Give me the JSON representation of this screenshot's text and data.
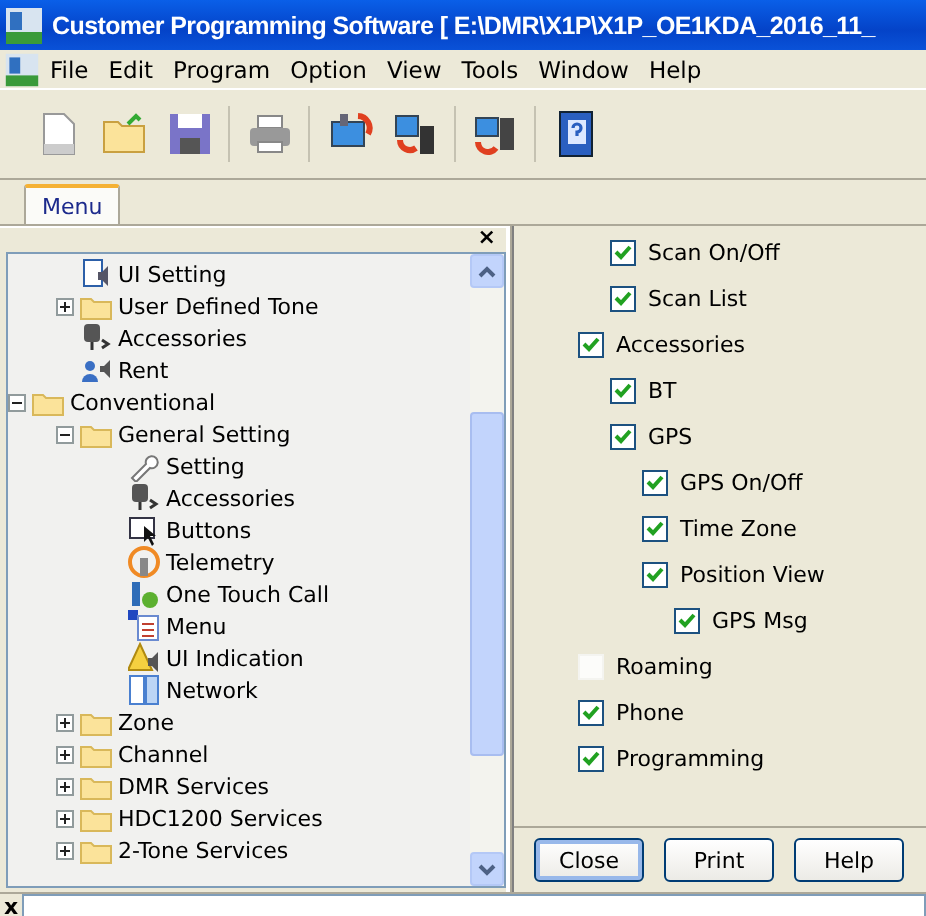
{
  "window": {
    "title": "Customer Programming Software [ E:\\DMR\\X1P\\X1P_OE1KDA_2016_11_"
  },
  "menu_bar": [
    "File",
    "Edit",
    "Program",
    "Option",
    "View",
    "Tools",
    "Window",
    "Help"
  ],
  "toolbar": [
    {
      "kind": "new"
    },
    {
      "kind": "open"
    },
    {
      "kind": "save"
    },
    {
      "kind": "sep"
    },
    {
      "kind": "print"
    },
    {
      "kind": "sep"
    },
    {
      "kind": "read"
    },
    {
      "kind": "write"
    },
    {
      "kind": "sep"
    },
    {
      "kind": "clone"
    },
    {
      "kind": "sep"
    },
    {
      "kind": "help"
    }
  ],
  "tabs": [
    {
      "label": "Menu",
      "selected": true
    }
  ],
  "tree_panel": {
    "close": "×",
    "items": [
      {
        "children": [
          {
            "label": "UI Setting",
            "kind": "ui"
          },
          {
            "label": "User Defined Tone",
            "kind": "folder",
            "expanded": false
          },
          {
            "label": "Accessories",
            "kind": "mic"
          },
          {
            "label": "Rent",
            "kind": "person"
          }
        ]
      },
      {
        "label": "Conventional",
        "kind": "folder",
        "expanded": true,
        "children": [
          {
            "label": "General Setting",
            "kind": "folder",
            "expanded": true,
            "children": [
              {
                "label": "Setting",
                "kind": "wrench"
              },
              {
                "label": "Accessories",
                "kind": "mic"
              },
              {
                "label": "Buttons",
                "kind": "cursor"
              },
              {
                "label": "Telemetry",
                "kind": "signal"
              },
              {
                "label": "One Touch Call",
                "kind": "phone"
              },
              {
                "label": "Menu",
                "kind": "list"
              },
              {
                "label": "UI Indication",
                "kind": "warning"
              },
              {
                "label": "Network",
                "kind": "network"
              }
            ]
          },
          {
            "label": "Zone",
            "kind": "folder",
            "expanded": false
          },
          {
            "label": "Channel",
            "kind": "folder",
            "expanded": false
          },
          {
            "label": "DMR Services",
            "kind": "folder",
            "expanded": false
          },
          {
            "label": "HDC1200 Services",
            "kind": "folder",
            "expanded": false
          },
          {
            "label": "2-Tone Services",
            "kind": "folder",
            "expanded": false
          }
        ]
      }
    ]
  },
  "menu_options": [
    {
      "children": [
        {
          "label": "Scan On/Off",
          "checked": true
        },
        {
          "label": "Scan List",
          "checked": true
        }
      ]
    },
    {
      "label": "Accessories",
      "checked": true,
      "children": [
        {
          "label": "BT",
          "checked": true
        },
        {
          "label": "GPS",
          "checked": true,
          "children": [
            {
              "label": "GPS On/Off",
              "checked": true
            },
            {
              "label": "Time Zone",
              "checked": true
            },
            {
              "label": "Position View",
              "checked": true,
              "children": [
                {
                  "label": "GPS Msg",
                  "checked": true
                }
              ]
            }
          ]
        }
      ]
    },
    {
      "label": "Roaming",
      "checked": false
    },
    {
      "label": "Phone",
      "checked": true
    },
    {
      "label": "Programming",
      "checked": true
    }
  ],
  "buttons": [
    {
      "label": "Close",
      "focused": true
    },
    {
      "label": "Print",
      "focused": false
    },
    {
      "label": "Help",
      "focused": false
    }
  ],
  "bottom_panel": {
    "close": "x"
  }
}
